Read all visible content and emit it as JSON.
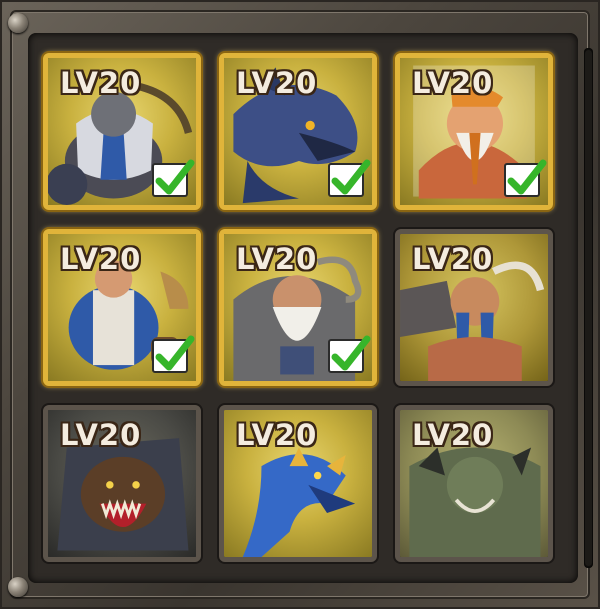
{
  "heroes": [
    {
      "name": "armored-dwarf-warrior",
      "level": "LV20",
      "selected": true,
      "checked": true,
      "tint": "#c4b34a",
      "accent": "#2f5aa8"
    },
    {
      "name": "blue-wolf",
      "level": "LV20",
      "selected": true,
      "checked": true,
      "tint": "#c8b43f",
      "accent": "#3c5aa0"
    },
    {
      "name": "bearded-dwarf-chieftain",
      "level": "LV20",
      "selected": true,
      "checked": true,
      "tint": "#d8c25a",
      "accent": "#d0701e"
    },
    {
      "name": "dwarf-drummer",
      "level": "LV20",
      "selected": true,
      "checked": true,
      "tint": "#c9b446",
      "accent": "#2f5aa8"
    },
    {
      "name": "dwarf-elder",
      "level": "LV20",
      "selected": true,
      "checked": true,
      "tint": "#c2ae44",
      "accent": "#3f4f78"
    },
    {
      "name": "horned-dwarf",
      "level": "LV20",
      "selected": false,
      "checked": false,
      "tint": "#bfa843",
      "accent": "#2f5aa8"
    },
    {
      "name": "armored-bear",
      "level": "LV20",
      "selected": false,
      "checked": false,
      "tint": "#a99a48",
      "accent": "#3a63b5"
    },
    {
      "name": "blue-dragon",
      "level": "LV20",
      "selected": false,
      "checked": false,
      "tint": "#c7b145",
      "accent": "#3569c7"
    },
    {
      "name": "green-troll",
      "level": "LV20",
      "selected": false,
      "checked": false,
      "tint": "#9f9a55",
      "accent": "#5f6b4d"
    }
  ]
}
